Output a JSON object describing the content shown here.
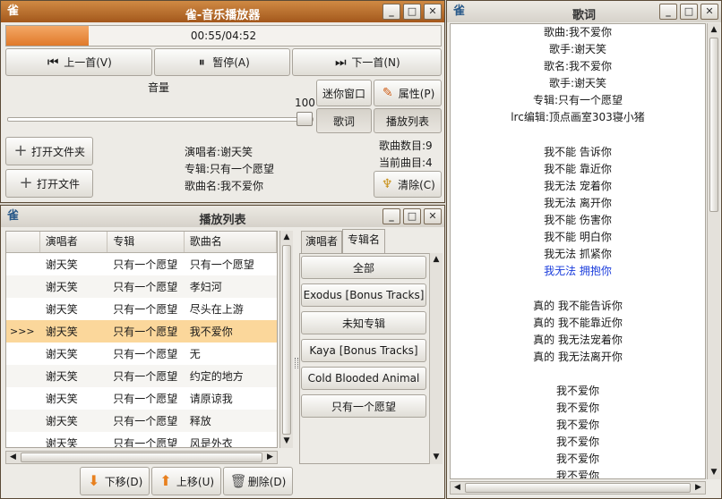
{
  "player": {
    "title": "雀-音乐播放器",
    "app_icon": "雀",
    "time": "00:55/04:52",
    "progress": 0.19,
    "prev_label": "上一首(V)",
    "pause_label": "暂停(A)",
    "next_label": "下一首(N)",
    "volume_label": "音量",
    "volume_value": "100",
    "mini_label": "迷你窗口",
    "props_label": "属性(P)",
    "lyrics_label": "歌词",
    "playlist_label": "播放列表",
    "open_folder_label": "打开文件夹",
    "open_file_label": "打开文件",
    "singer": "演唱者:谢天笑",
    "album": "专辑:只有一个愿望",
    "song": "歌曲名:我不爱你",
    "song_count": "歌曲数目:9",
    "current_song": "当前曲目:4",
    "clear_label": "清除(C)"
  },
  "window_buttons": {
    "minimize": "_",
    "maximize": "□",
    "close": "✕"
  },
  "playlist": {
    "title": "播放列表",
    "columns": [
      "",
      "演唱者",
      "专辑",
      "歌曲名"
    ],
    "current_marker": ">>>",
    "rows": [
      {
        "singer": "谢天笑",
        "album": "只有一个愿望",
        "song": "只有一个愿望",
        "marker": ""
      },
      {
        "singer": "谢天笑",
        "album": "只有一个愿望",
        "song": "孝妇河",
        "marker": ""
      },
      {
        "singer": "谢天笑",
        "album": "只有一个愿望",
        "song": "尽头在上游",
        "marker": ""
      },
      {
        "singer": "谢天笑",
        "album": "只有一个愿望",
        "song": "我不爱你",
        "marker": ">>>"
      },
      {
        "singer": "谢天笑",
        "album": "只有一个愿望",
        "song": "无",
        "marker": ""
      },
      {
        "singer": "谢天笑",
        "album": "只有一个愿望",
        "song": "约定的地方",
        "marker": ""
      },
      {
        "singer": "谢天笑",
        "album": "只有一个愿望",
        "song": "请原谅我",
        "marker": ""
      },
      {
        "singer": "谢天笑",
        "album": "只有一个愿望",
        "song": "释放",
        "marker": ""
      },
      {
        "singer": "谢天笑",
        "album": "只有一个愿望",
        "song": "风是外衣",
        "marker": ""
      }
    ],
    "tab_singer": "演唱者",
    "tab_album": "专辑名",
    "albums": [
      "全部",
      "Exodus [Bonus Tracks]",
      "未知专辑",
      "Kaya [Bonus Tracks]",
      "Cold Blooded Animal",
      "只有一个愿望"
    ],
    "down_label": "下移(D)",
    "up_label": "上移(U)",
    "delete_label": "删除(D)"
  },
  "lyrics": {
    "title": "歌词",
    "lines": [
      "歌曲:我不爱你",
      "歌手:谢天笑",
      "歌名:我不爱你",
      "歌手:谢天笑",
      "专辑:只有一个愿望",
      "lrc编辑:顶点画室303寝小猪",
      "",
      "我不能 告诉你",
      "我不能 靠近你",
      "我无法 宠着你",
      "我无法 离开你",
      "我不能 伤害你",
      "我不能 明白你",
      "我无法 抓紧你",
      "我无法 拥抱你",
      "",
      "真的 我不能告诉你",
      "真的 我不能靠近你",
      "真的 我无法宠着你",
      "真的 我无法离开你",
      "",
      "我不爱你",
      "我不爱你",
      "我不爱你",
      "我不爱你",
      "我不爱你",
      "我不爱你"
    ],
    "highlight_index": 14
  },
  "colors": {
    "accent": "#d07a34",
    "highlight_row": "#fbd79b",
    "lyric_highlight": "#1a3cdc"
  }
}
